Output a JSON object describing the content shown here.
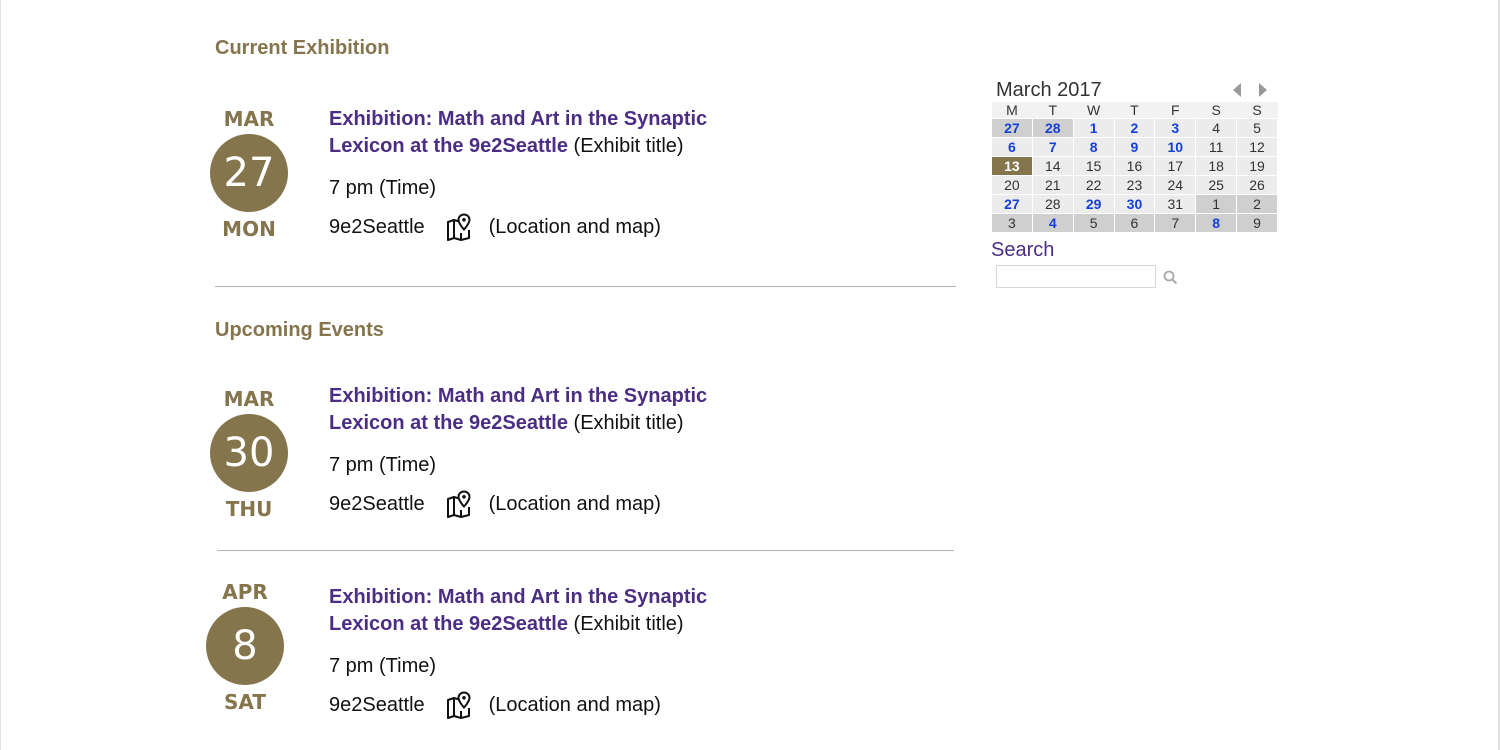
{
  "current": {
    "heading": "Current Exhibition",
    "event": {
      "month": "MAR",
      "day": "27",
      "weekday": "MON",
      "title_line1": "Exhibition: Math and Art in the Synaptic",
      "title_line2": "Lexicon at the 9e2Seattle",
      "title_note": " (Exhibit title)",
      "time": "7 pm (Time)",
      "location": "9e2Seattle",
      "location_note": "(Location and map)"
    }
  },
  "upcoming": {
    "heading": "Upcoming Events",
    "events": [
      {
        "month": "MAR",
        "day": "30",
        "weekday": "THU",
        "title_line1": "Exhibition: Math and Art in the Synaptic",
        "title_line2": "Lexicon at the 9e2Seattle",
        "title_note": " (Exhibit title)",
        "time": "7 pm (Time)",
        "location": "9e2Seattle",
        "location_note": "(Location and map)"
      },
      {
        "month": "APR",
        "day": "8",
        "weekday": "SAT",
        "title_line1": "Exhibition: Math and Art in the Synaptic",
        "title_line2": "Lexicon at the 9e2Seattle",
        "title_note": " (Exhibit title)",
        "time": "7 pm (Time)",
        "location": "9e2Seattle",
        "location_note": "(Location and map)"
      }
    ]
  },
  "calendar": {
    "month_label": "March 2017",
    "weekdays": [
      "M",
      "T",
      "W",
      "T",
      "F",
      "S",
      "S"
    ],
    "weeks": [
      [
        {
          "d": "27",
          "other": true,
          "link": true
        },
        {
          "d": "28",
          "other": true,
          "link": true
        },
        {
          "d": "1",
          "link": true
        },
        {
          "d": "2",
          "link": true
        },
        {
          "d": "3",
          "link": true
        },
        {
          "d": "4"
        },
        {
          "d": "5"
        }
      ],
      [
        {
          "d": "6",
          "link": true
        },
        {
          "d": "7",
          "link": true
        },
        {
          "d": "8",
          "link": true
        },
        {
          "d": "9",
          "link": true
        },
        {
          "d": "10",
          "link": true
        },
        {
          "d": "11"
        },
        {
          "d": "12"
        }
      ],
      [
        {
          "d": "13",
          "today": true
        },
        {
          "d": "14"
        },
        {
          "d": "15"
        },
        {
          "d": "16"
        },
        {
          "d": "17"
        },
        {
          "d": "18"
        },
        {
          "d": "19"
        }
      ],
      [
        {
          "d": "20"
        },
        {
          "d": "21"
        },
        {
          "d": "22"
        },
        {
          "d": "23"
        },
        {
          "d": "24"
        },
        {
          "d": "25"
        },
        {
          "d": "26"
        }
      ],
      [
        {
          "d": "27",
          "link": true
        },
        {
          "d": "28"
        },
        {
          "d": "29",
          "link": true
        },
        {
          "d": "30",
          "link": true
        },
        {
          "d": "31"
        },
        {
          "d": "1",
          "other": true
        },
        {
          "d": "2",
          "other": true
        }
      ],
      [
        {
          "d": "3",
          "other": true
        },
        {
          "d": "4",
          "other": true,
          "link": true
        },
        {
          "d": "5",
          "other": true
        },
        {
          "d": "6",
          "other": true
        },
        {
          "d": "7",
          "other": true
        },
        {
          "d": "8",
          "other": true,
          "link": true
        },
        {
          "d": "9",
          "other": true
        }
      ]
    ]
  },
  "search": {
    "label": "Search",
    "value": "",
    "placeholder": ""
  },
  "colors": {
    "gold": "#85754d",
    "purple": "#4b2e83",
    "calendar_link": "#1540d8"
  }
}
